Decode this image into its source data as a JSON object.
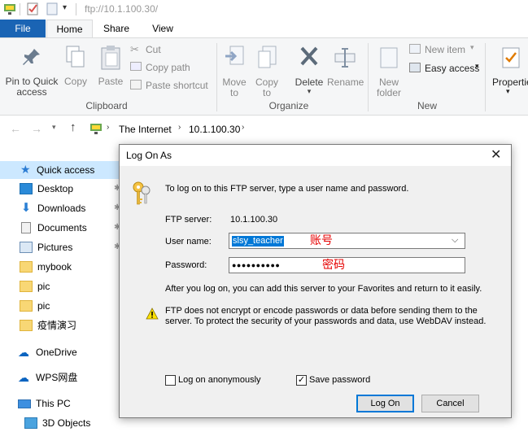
{
  "titlebar": {
    "path": "ftp://10.1.100.30/"
  },
  "tabs": {
    "file": "File",
    "home": "Home",
    "share": "Share",
    "view": "View"
  },
  "ribbon": {
    "pin_line1": "Pin to Quick",
    "pin_line2": "access",
    "copy": "Copy",
    "paste": "Paste",
    "cut": "Cut",
    "copy_path": "Copy path",
    "paste_shortcut": "Paste shortcut",
    "clipboard_group": "Clipboard",
    "move_to_line1": "Move",
    "move_to_line2": "to",
    "copy_to_line1": "Copy",
    "copy_to_line2": "to",
    "delete": "Delete",
    "rename": "Rename",
    "organize_group": "Organize",
    "new_folder_line1": "New",
    "new_folder_line2": "folder",
    "new_item": "New item",
    "easy_access": "Easy access",
    "new_group": "New",
    "properties": "Properties"
  },
  "address": {
    "crumb1": "The Internet",
    "crumb2": "10.1.100.30"
  },
  "nav": {
    "quick_access": "Quick access",
    "desktop": "Desktop",
    "downloads": "Downloads",
    "documents": "Documents",
    "pictures": "Pictures",
    "mybook": "mybook",
    "pic1": "pic",
    "pic2": "pic",
    "epidemic": "疫情演习",
    "onedrive": "OneDrive",
    "wps": "WPS网盘",
    "this_pc": "This PC",
    "objects3d": "3D Objects"
  },
  "dialog": {
    "title": "Log On As",
    "intro": "To log on to this FTP server, type a user name and password.",
    "server_label": "FTP server:",
    "server_value": "10.1.100.30",
    "username_label": "User name:",
    "username_value": "slsy_teacher",
    "username_annotation": "账号",
    "password_label": "Password:",
    "password_value": "●●●●●●●●●●",
    "password_annotation": "密码",
    "after_logon": "After you log on, you can add this server to your Favorites and return to it easily.",
    "warning_line1": "FTP does not encrypt or encode passwords or data before sending them to the",
    "warning_line2": "server.  To protect the security of your passwords and data, use WebDAV instead.",
    "anon_label": "Log on anonymously",
    "save_pw_label": "Save password",
    "logon_button": "Log On",
    "cancel_button": "Cancel"
  },
  "colors": {
    "file_tab": "#1a64b4",
    "annotation_red": "#e60000",
    "selection": "#0078d7",
    "quick_access_bg": "#cce8ff"
  }
}
